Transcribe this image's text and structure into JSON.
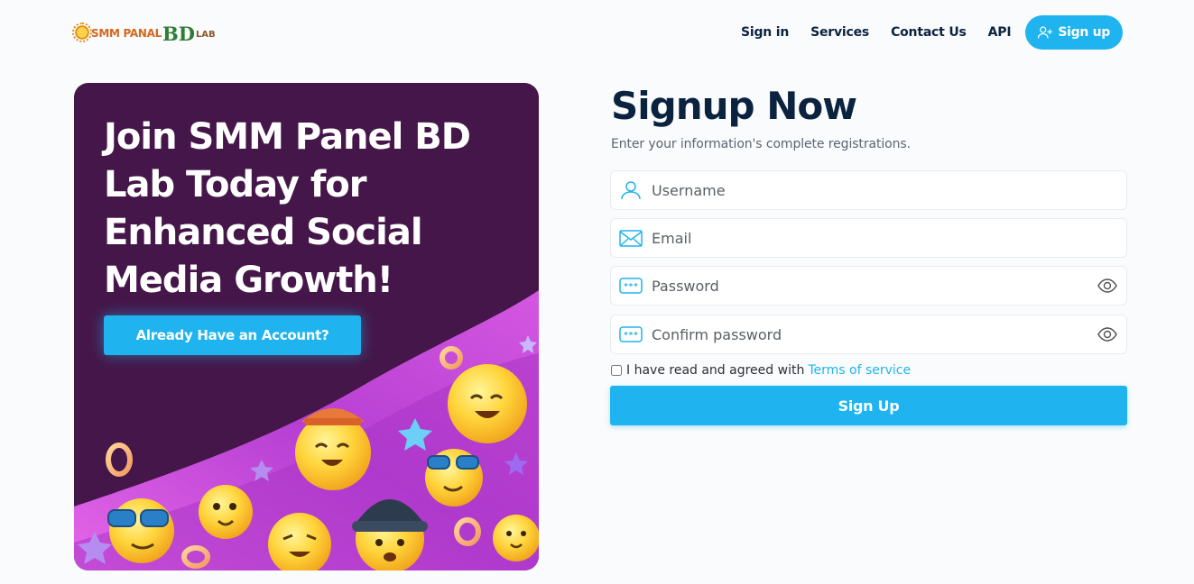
{
  "brand": {
    "logo_alt": "SMM PANAL BD LAB",
    "logo_smm": "SMM PANAL",
    "logo_bd": "BD",
    "logo_lab": "LAB"
  },
  "nav": {
    "items": [
      {
        "label": "Sign in"
      },
      {
        "label": "Services"
      },
      {
        "label": "Contact Us"
      },
      {
        "label": "API"
      }
    ],
    "signup_label": "Sign up",
    "signup_icon": "user-plus-icon"
  },
  "hero": {
    "title": "Join SMM Panel BD Lab Today for Enhanced Social Media Growth!",
    "button_label": "Already Have an Account?",
    "background_color": "#451649",
    "wave_color": "#c44ddb"
  },
  "form": {
    "title": "Signup Now",
    "subtitle": "Enter your information's complete registrations.",
    "fields": [
      {
        "placeholder": "Username",
        "icon": "user-icon",
        "value": ""
      },
      {
        "placeholder": "Email",
        "icon": "envelope-icon",
        "value": ""
      },
      {
        "placeholder": "Password",
        "icon": "password-icon",
        "value": "",
        "reveal_icon": "eye-icon"
      },
      {
        "placeholder": "Confirm password",
        "icon": "password-icon",
        "value": "",
        "reveal_icon": "eye-icon"
      }
    ],
    "terms_text": "I have read and agreed with",
    "terms_link": "Terms of service",
    "terms_checked": false,
    "submit_label": "Sign Up"
  },
  "colors": {
    "accent": "#1fb4ef",
    "heading": "#0c2340",
    "page_background": "#fafbfc"
  }
}
